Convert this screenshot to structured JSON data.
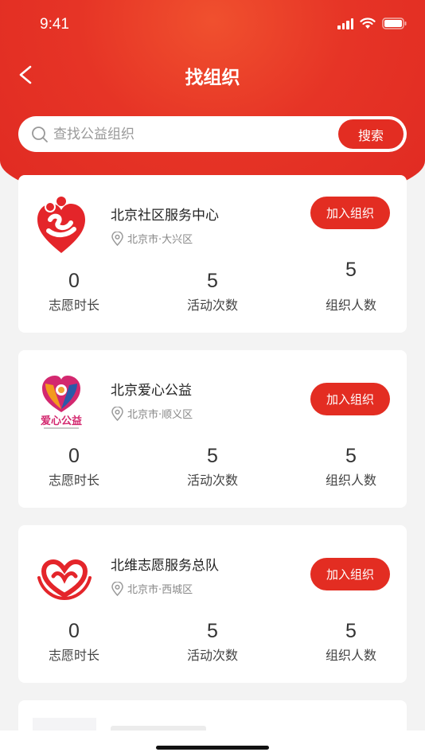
{
  "status_bar": {
    "time": "9:41"
  },
  "nav": {
    "title": "找组织"
  },
  "search": {
    "placeholder": "查找公益组织",
    "button_label": "搜索"
  },
  "colors": {
    "brand_red": "#e32d22",
    "text_gray": "#888888"
  },
  "icons": [
    "back-chevron-icon",
    "search-icon",
    "location-pin-icon",
    "signal-icon",
    "wifi-icon",
    "battery-icon"
  ],
  "organizations": [
    {
      "name": "北京社区服务中心",
      "location": "北京市·大兴区",
      "join_label": "加入组织",
      "stats": [
        {
          "value": "0",
          "label": "志愿时长"
        },
        {
          "value": "5",
          "label": "活动次数"
        },
        {
          "value": "5",
          "label": "组织人数"
        }
      ]
    },
    {
      "name": "北京爱心公益",
      "location": "北京市·顺义区",
      "join_label": "加入组织",
      "logo_text": "爱心公益",
      "stats": [
        {
          "value": "0",
          "label": "志愿时长"
        },
        {
          "value": "5",
          "label": "活动次数"
        },
        {
          "value": "5",
          "label": "组织人数"
        }
      ]
    },
    {
      "name": "北维志愿服务总队",
      "location": "北京市·西城区",
      "join_label": "加入组织",
      "stats": [
        {
          "value": "0",
          "label": "志愿时长"
        },
        {
          "value": "5",
          "label": "活动次数"
        },
        {
          "value": "5",
          "label": "组织人数"
        }
      ]
    }
  ]
}
